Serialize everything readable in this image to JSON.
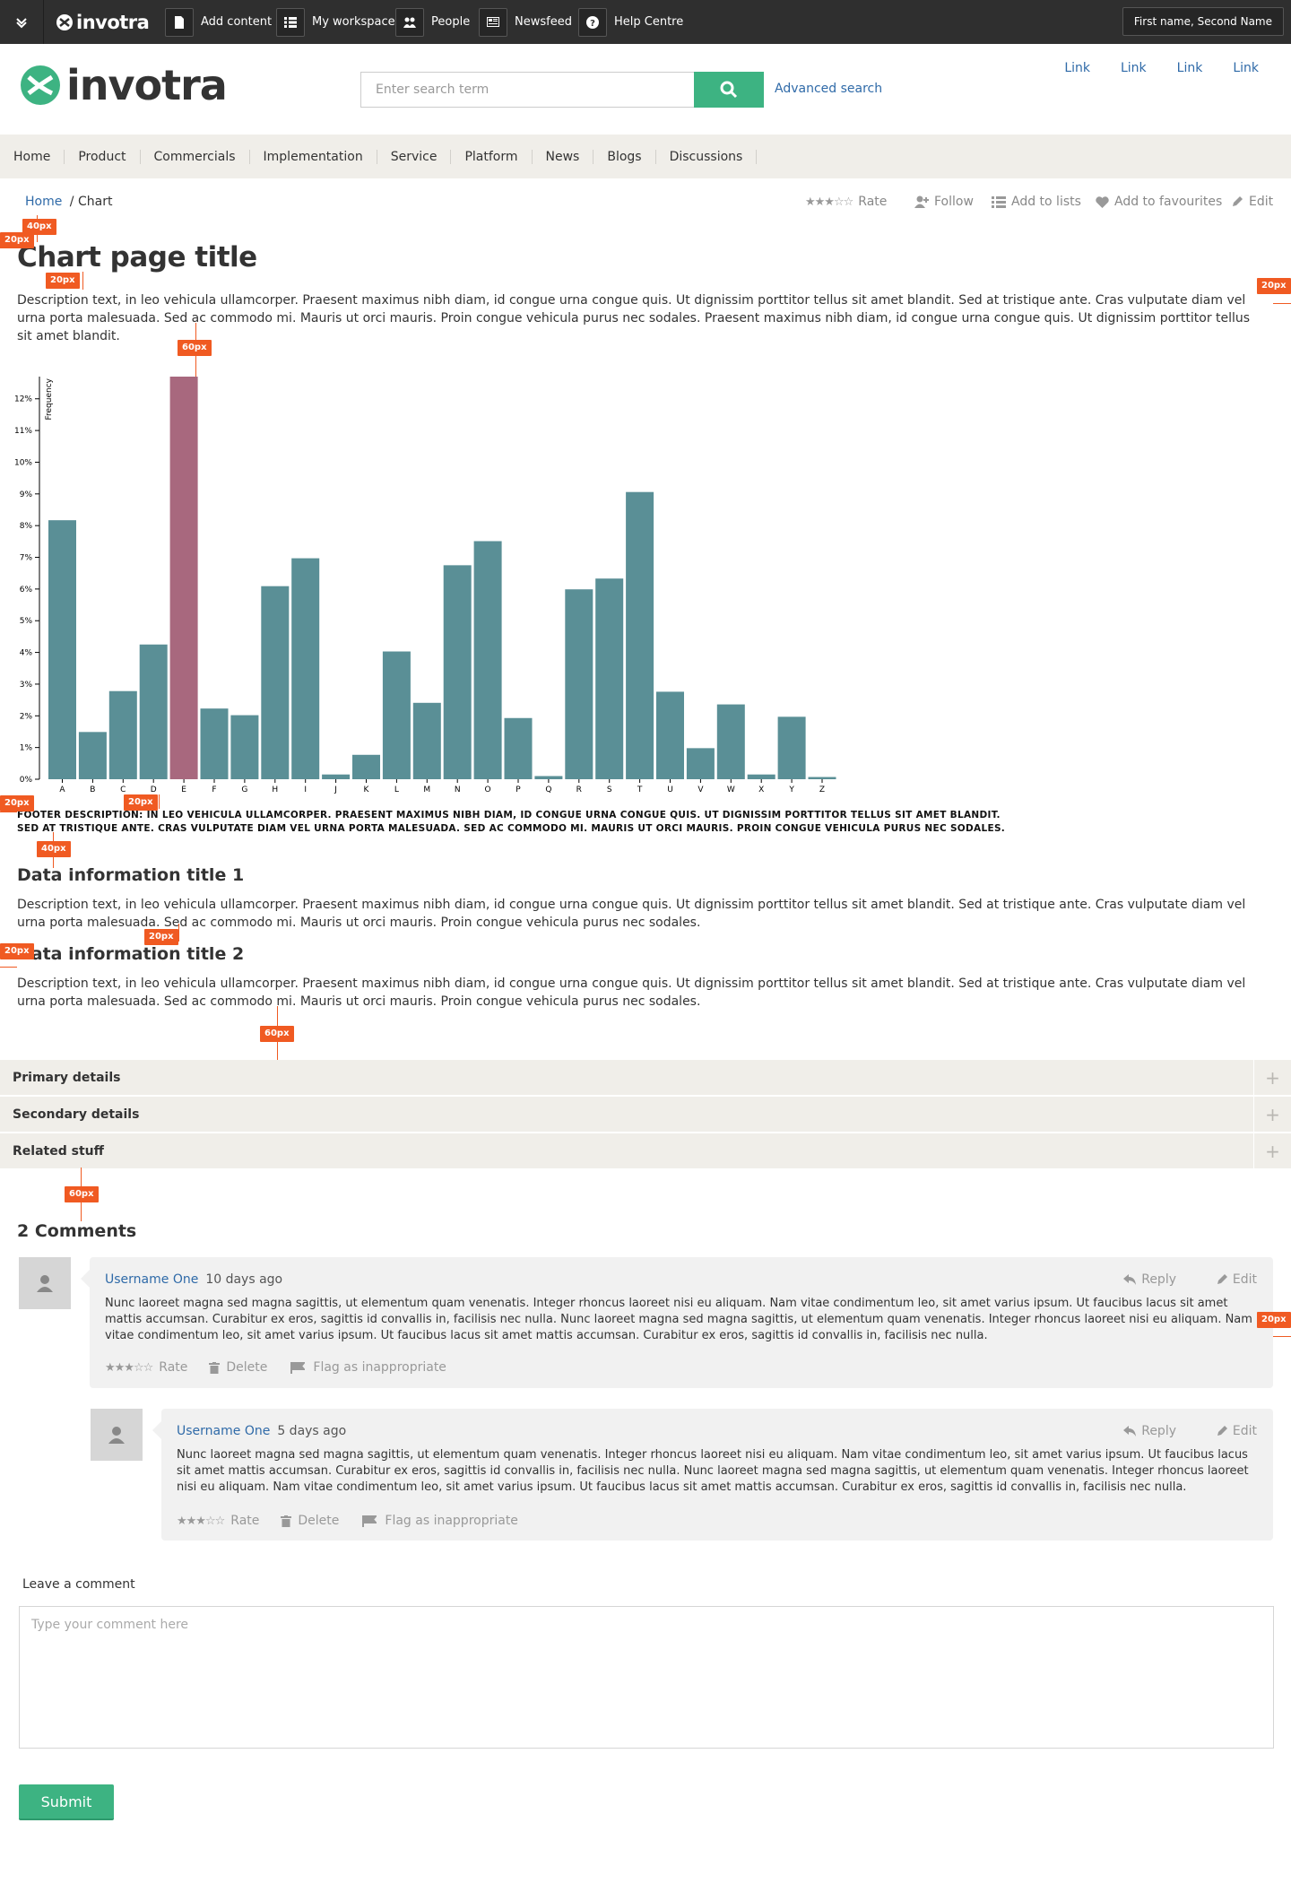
{
  "topbar": {
    "logo": "invotra",
    "items": [
      "Add content",
      "My workspace",
      "People",
      "Newsfeed",
      "Help Centre"
    ],
    "user": "First name, Second Name"
  },
  "header": {
    "logo": "invotra",
    "search_placeholder": "Enter search term",
    "advanced_search": "Advanced search",
    "links": [
      "Link",
      "Link",
      "Link",
      "Link"
    ]
  },
  "nav": [
    "Home",
    "Product",
    "Commercials",
    "Implementation",
    "Service",
    "Platform",
    "News",
    "Blogs",
    "Discussions"
  ],
  "breadcrumb": {
    "home": "Home",
    "current": "/ Chart"
  },
  "actions": {
    "rate": "Rate",
    "follow": "Follow",
    "add_to_lists": "Add to lists",
    "add_to_favourites": "Add to favourites",
    "edit": "Edit"
  },
  "page": {
    "title": "Chart page title",
    "description": "Description text, in leo vehicula ullamcorper. Praesent maximus nibh diam, id congue urna congue quis. Ut dignissim porttitor tellus sit amet blandit. Sed at tristique ante. Cras vulputate diam vel urna porta malesuada. Sed ac commodo mi. Mauris ut orci mauris. Proin congue vehicula purus nec sodales. Praesent maximus nibh diam, id congue urna congue quis. Ut dignissim porttitor tellus sit amet blandit.",
    "footer_description": "FOOTER DESCRIPTION: IN LEO VEHICULA ULLAMCORPER. PRAESENT MAXIMUS NIBH DIAM, ID CONGUE URNA CONGUE QUIS. UT DIGNISSIM PORTTITOR TELLUS SIT AMET BLANDIT. SED AT TRISTIQUE ANTE. CRAS VULPUTATE DIAM VEL URNA PORTA MALESUADA. SED AC COMMODO MI. MAURIS UT ORCI MAURIS. PROIN CONGUE VEHICULA PURUS NEC SODALES."
  },
  "chart_data": {
    "type": "bar",
    "ylabel": "Frequency",
    "categories": [
      "A",
      "B",
      "C",
      "D",
      "E",
      "F",
      "G",
      "H",
      "I",
      "J",
      "K",
      "L",
      "M",
      "N",
      "O",
      "P",
      "Q",
      "R",
      "S",
      "T",
      "U",
      "V",
      "W",
      "X",
      "Y",
      "Z"
    ],
    "values": [
      8.17,
      1.49,
      2.78,
      4.25,
      12.7,
      2.23,
      2.02,
      6.09,
      6.97,
      0.15,
      0.77,
      4.03,
      2.41,
      6.75,
      7.51,
      1.93,
      0.1,
      5.99,
      6.33,
      9.06,
      2.76,
      0.98,
      2.36,
      0.15,
      1.97,
      0.07
    ],
    "highlight_index": 4,
    "ylim": [
      0,
      12.7
    ],
    "yticks": [
      "0%",
      "1%",
      "2%",
      "3%",
      "4%",
      "5%",
      "6%",
      "7%",
      "8%",
      "9%",
      "10%",
      "11%",
      "12%"
    ],
    "colors": {
      "bar": "#5a8f96",
      "highlight": "#a8687e"
    }
  },
  "sections": [
    {
      "title": "Data information title 1",
      "text": "Description text, in leo vehicula ullamcorper. Praesent maximus nibh diam, id congue urna congue quis. Ut dignissim porttitor tellus sit amet blandit. Sed at tristique ante. Cras vulputate diam vel urna porta malesuada. Sed ac commodo mi. Mauris ut orci mauris. Proin congue vehicula purus nec sodales."
    },
    {
      "title": "Data information title 2",
      "text": "Description text, in leo vehicula ullamcorper. Praesent maximus nibh diam, id congue urna congue quis. Ut dignissim porttitor tellus sit amet blandit. Sed at tristique ante. Cras vulputate diam vel urna porta malesuada. Sed ac commodo mi. Mauris ut orci mauris. Proin congue vehicula purus nec sodales."
    }
  ],
  "accordion": [
    "Primary details",
    "Secondary details",
    "Related stuff"
  ],
  "spacing_markers": {
    "m40": "40px",
    "m20": "20px",
    "m60": "60px"
  },
  "comments": {
    "heading": "2 Comments",
    "items": [
      {
        "user": "Username One",
        "date": "10 days ago",
        "reply": "Reply",
        "edit": "Edit",
        "text": "Nunc laoreet magna sed magna sagittis, ut elementum quam venenatis. Integer rhoncus laoreet nisi eu aliquam. Nam vitae condimentum leo, sit amet varius ipsum. Ut faucibus lacus sit amet mattis accumsan. Curabitur ex eros, sagittis id convallis in, facilisis nec nulla. Nunc laoreet magna sed magna sagittis, ut elementum quam venenatis. Integer rhoncus laoreet nisi eu aliquam. Nam vitae condimentum leo, sit amet varius ipsum. Ut faucibus lacus sit amet mattis accumsan. Curabitur ex eros, sagittis id convallis in, facilisis nec nulla.",
        "rate": "Rate",
        "delete": "Delete",
        "flag": "Flag as inappropriate"
      },
      {
        "user": "Username One",
        "date": "5 days ago",
        "reply": "Reply",
        "edit": "Edit",
        "text": "Nunc laoreet magna sed magna sagittis, ut elementum quam venenatis. Integer rhoncus laoreet nisi eu aliquam. Nam vitae condimentum leo, sit amet varius ipsum. Ut faucibus lacus sit amet mattis accumsan. Curabitur ex eros, sagittis id convallis in, facilisis nec nulla. Nunc laoreet magna sed magna sagittis, ut elementum quam venenatis. Integer rhoncus laoreet nisi eu aliquam. Nam vitae condimentum leo, sit amet varius ipsum. Ut faucibus lacus sit amet mattis accumsan. Curabitur ex eros, sagittis id convallis in, facilisis nec nulla.",
        "rate": "Rate",
        "delete": "Delete",
        "flag": "Flag as inappropriate"
      }
    ]
  },
  "leave_comment": {
    "label": "Leave a comment",
    "placeholder": "Type your comment here",
    "submit": "Submit"
  },
  "colors": {
    "accent": "#3db382",
    "link": "#2f6aa8",
    "marker": "#f05a22",
    "nav_bg": "#f0eee9",
    "topbar_bg": "#2f2f2f"
  }
}
